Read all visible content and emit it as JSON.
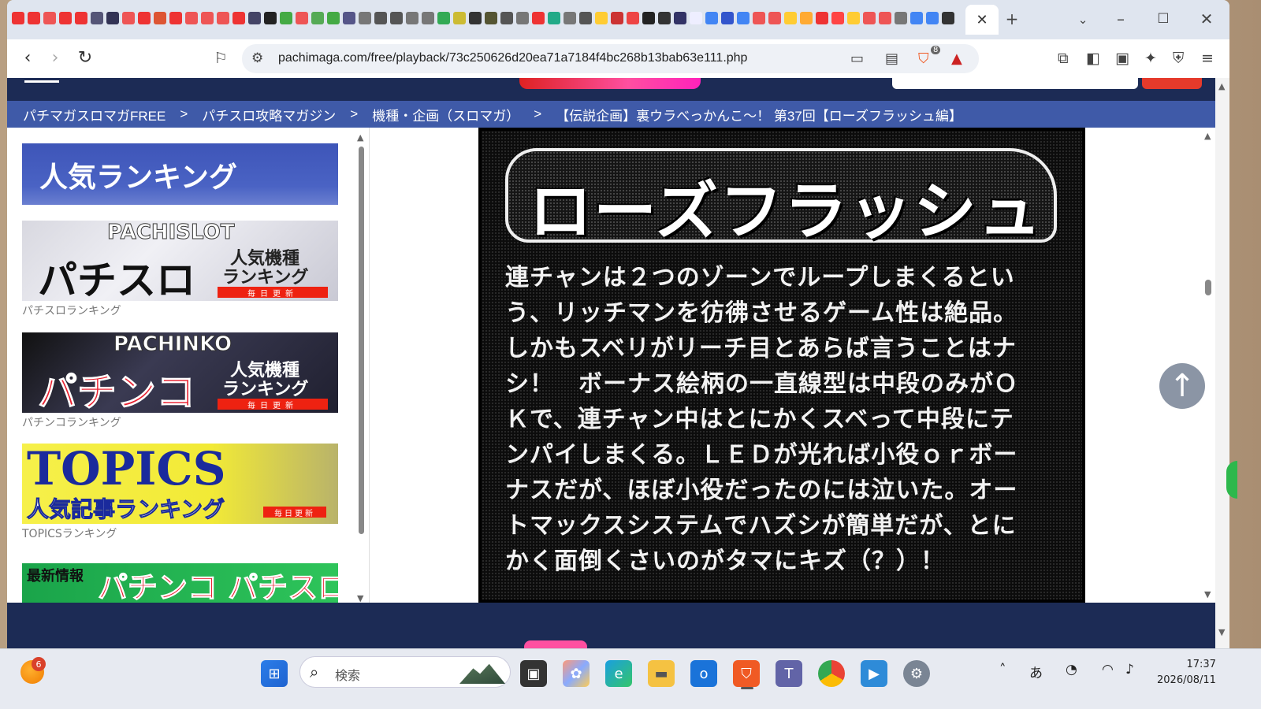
{
  "browser": {
    "tab_close": "✕",
    "new_tab": "+",
    "url": "pachimaga.com/free/playback/73c250626d20ea71a7184f4bc268b13bab63e111.php",
    "shield_badge": "8",
    "favicon_colors": [
      "#e33",
      "#e33",
      "#e55",
      "#e33",
      "#e33",
      "#557",
      "#335",
      "#e55",
      "#e33",
      "#d53",
      "#e33",
      "#e55",
      "#e55",
      "#e55",
      "#e33",
      "#446",
      "#222",
      "#4a4",
      "#e55",
      "#5a5",
      "#4a4",
      "#558",
      "#777",
      "#555",
      "#555",
      "#777",
      "#777",
      "#3a5",
      "#cb3",
      "#333",
      "#553",
      "#555",
      "#777",
      "#e33",
      "#2a8",
      "#777",
      "#555",
      "#fc3",
      "#c33",
      "#e44",
      "#222",
      "#333",
      "#336",
      "#eef",
      "#4285f4",
      "#35c",
      "#4285f4",
      "#e55",
      "#e55",
      "#fc3",
      "#fa3",
      "#e33",
      "#f44",
      "#fc3",
      "#e55",
      "#e55",
      "#777",
      "#4285f4",
      "#4285f4",
      "#333"
    ]
  },
  "site": {
    "breadcrumb": [
      "パチマガスロマガFREE",
      "パチスロ攻略マガジン",
      "機種・企画（スロマガ）",
      "【伝説企画】裏ウラべっかんこ～！ 第37回【ローズフラッシュ編】"
    ],
    "breadcrumb_sep": ">",
    "sidebar": {
      "ranking_title": "人気ランキング",
      "banners": [
        {
          "top": "PACHISLOT",
          "main": "パチスロ",
          "sub1": "人気機種",
          "sub2": "ランキング",
          "strip": "毎日更新",
          "caption": "パチスロランキング"
        },
        {
          "top": "PACHINKO",
          "main": "パチンコ",
          "sub1": "人気機種",
          "sub2": "ランキング",
          "strip": "毎日更新",
          "caption": "パチンコランキング"
        },
        {
          "top": "TOPICS",
          "main": "人気記事ランキング",
          "strip": "毎日更新",
          "caption": "TOPICSランキング"
        },
        {
          "top": "最新情報",
          "main": "パチンコ パチスロ"
        }
      ]
    },
    "article": {
      "scan_title": "ローズフラッシュ",
      "scan_lines": [
        "連チャンは２つのゾーンでループしまくるとい",
        "う、リッチマンを彷彿させるゲーム性は絶品。",
        "しかもスベリがリーチ目とあらば言うことはナ",
        "シ！　ボーナス絵柄の一直線型は中段のみがＯ",
        "Ｋで、連チャン中はとにかくスベって中段にテ",
        "ンパイしまくる。ＬＥＤが光れば小役ｏｒボー",
        "ナスだが、ほぼ小役だったのには泣いた。オー",
        "トマックスシステムでハズシが簡単だが、とに",
        "かく面倒くさいのがタマにキズ（？）！"
      ]
    }
  },
  "taskbar": {
    "weather_badge": "6",
    "search_placeholder": "検索",
    "ime": "あ",
    "time": "17:37",
    "date": "2026/08/11"
  }
}
